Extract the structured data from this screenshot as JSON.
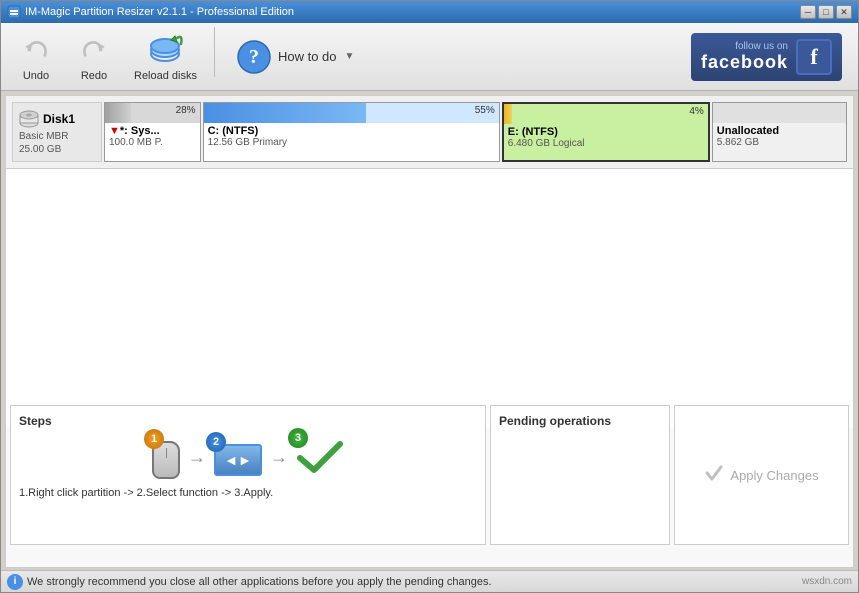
{
  "window": {
    "title": "IM-Magic Partition Resizer v2.1.1 - Professional Edition"
  },
  "titlebar": {
    "minimize": "─",
    "maximize": "□",
    "close": "✕"
  },
  "toolbar": {
    "undo_label": "Undo",
    "redo_label": "Redo",
    "reload_label": "Reload disks",
    "howto_label": "How to do"
  },
  "facebook": {
    "follow_text": "follow us on",
    "name": "facebook",
    "f_letter": "f"
  },
  "disk": {
    "label": "Disk1",
    "type": "Basic MBR",
    "size": "25.00 GB",
    "partitions": [
      {
        "id": "sys",
        "pct": "28%",
        "bar_pct": 28,
        "name": "*: Sys...",
        "detail": "100.0 MB P.",
        "type_class": "part-sys"
      },
      {
        "id": "c",
        "pct": "55%",
        "bar_pct": 55,
        "name": "C: (NTFS)",
        "detail": "12.56 GB Primary",
        "type_class": "part-c"
      },
      {
        "id": "e",
        "pct": "4%",
        "bar_pct": 4,
        "name": "E: (NTFS)",
        "detail": "6.480 GB Logical",
        "type_class": "part-e",
        "selected": true
      },
      {
        "id": "unalloc",
        "pct": "",
        "bar_pct": 0,
        "name": "Unallocated",
        "detail": "5.862 GB",
        "type_class": "part-unalloc"
      }
    ]
  },
  "steps": {
    "title": "Steps",
    "description": "1.Right click partition -> 2.Select function -> 3.Apply."
  },
  "pending": {
    "title": "Pending operations"
  },
  "apply": {
    "label": "Apply Changes"
  },
  "status": {
    "message": "We strongly recommend you close all other applications before you apply the pending changes.",
    "watermark": "wsxdn.com"
  }
}
